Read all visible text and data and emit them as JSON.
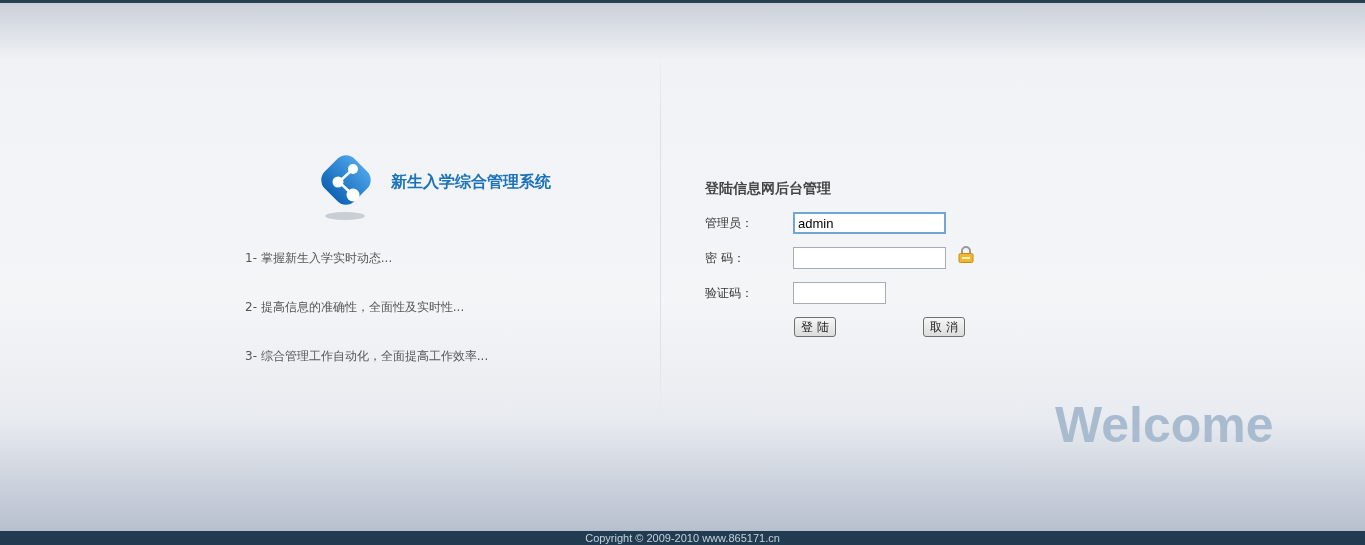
{
  "system_title": "新生入学综合管理系统",
  "features": [
    "1- 掌握新生入学实时动态...",
    "2- 提高信息的准确性，全面性及实时性...",
    "3- 综合管理工作自动化，全面提高工作效率..."
  ],
  "login": {
    "heading": "登陆信息网后台管理",
    "fields": [
      {
        "kind": "text",
        "label": "管理员：",
        "value": "admin",
        "focused": true
      },
      {
        "kind": "password",
        "label": "密 码：",
        "focused": false
      },
      {
        "kind": "captcha",
        "label": "验证码：",
        "focused": false
      }
    ],
    "buttons": [
      "登 陆",
      "取 消"
    ]
  },
  "welcome": "Welcome",
  "footer": "Copyright © 2009-2010 www.865171.cn"
}
